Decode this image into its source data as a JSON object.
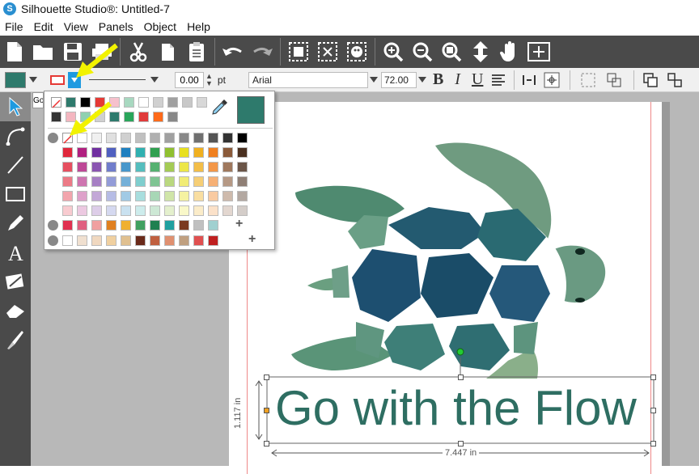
{
  "window": {
    "title": "Silhouette Studio®: Untitled-7"
  },
  "menu": {
    "items": [
      "File",
      "Edit",
      "View",
      "Panels",
      "Object",
      "Help"
    ]
  },
  "propbar": {
    "fill_color": "#2e7a6c",
    "line_color": "#e53935",
    "line_weight": "0.00",
    "line_unit": "pt",
    "font_name": "Arial",
    "font_size": "72.00",
    "bold": "B",
    "italic": "I",
    "underline": "U"
  },
  "popup": {
    "tab_stub": "Go",
    "recent_top": [
      "none",
      "#2e7a6c",
      "#000000",
      "#e53935",
      "#f6c1cc",
      "#a8d8c0",
      "#ffffff",
      "#d0d0d0",
      "#a0a0a0",
      "#c8c8c8",
      "#d8d8d8"
    ],
    "recent_bottom": [
      "#333333",
      "#f4b6c0",
      "#8fd0b0",
      "#d0d0d0",
      "#2e7a6c",
      "#29a55a",
      "#e03a3a",
      "#ff6a1a",
      "#888888"
    ],
    "current_color": "#2e7a6c",
    "grays": [
      "none",
      "#ffffff",
      "#f0f0f0",
      "#e0e0e0",
      "#d0d0d0",
      "#c0c0c0",
      "#b0b0b0",
      "#a0a0a0",
      "#888888",
      "#707070",
      "#555555",
      "#333333",
      "#000000"
    ],
    "hue_columns": [
      "#e0283c",
      "#b02080",
      "#7030a0",
      "#5060c0",
      "#2080c0",
      "#30b0b0",
      "#30a050",
      "#90c030",
      "#e8e020",
      "#f0b020",
      "#f08020",
      "#8a5a3a",
      "#4a3020"
    ],
    "custom_row_1": [
      "#e03050",
      "#e06080",
      "#f0a0a0",
      "#e08020",
      "#f0b030",
      "#40a060",
      "#208050",
      "#20a0a0",
      "#7a3a20",
      "#c0c0c0",
      "#a0d0d0"
    ],
    "custom_row_2": [
      "#ffffff",
      "#f0e0d0",
      "#f0d8c0",
      "#f0d0a0",
      "#e0c090",
      "#6a2a1a",
      "#c06040",
      "#e09070",
      "#c0a080",
      "#e05050",
      "#c02020"
    ],
    "plus": "+"
  },
  "canvas": {
    "text": "Go with the Flow",
    "height_label": "1.117 in",
    "width_label": "7.447 in",
    "text_color": "#2e6e62"
  }
}
